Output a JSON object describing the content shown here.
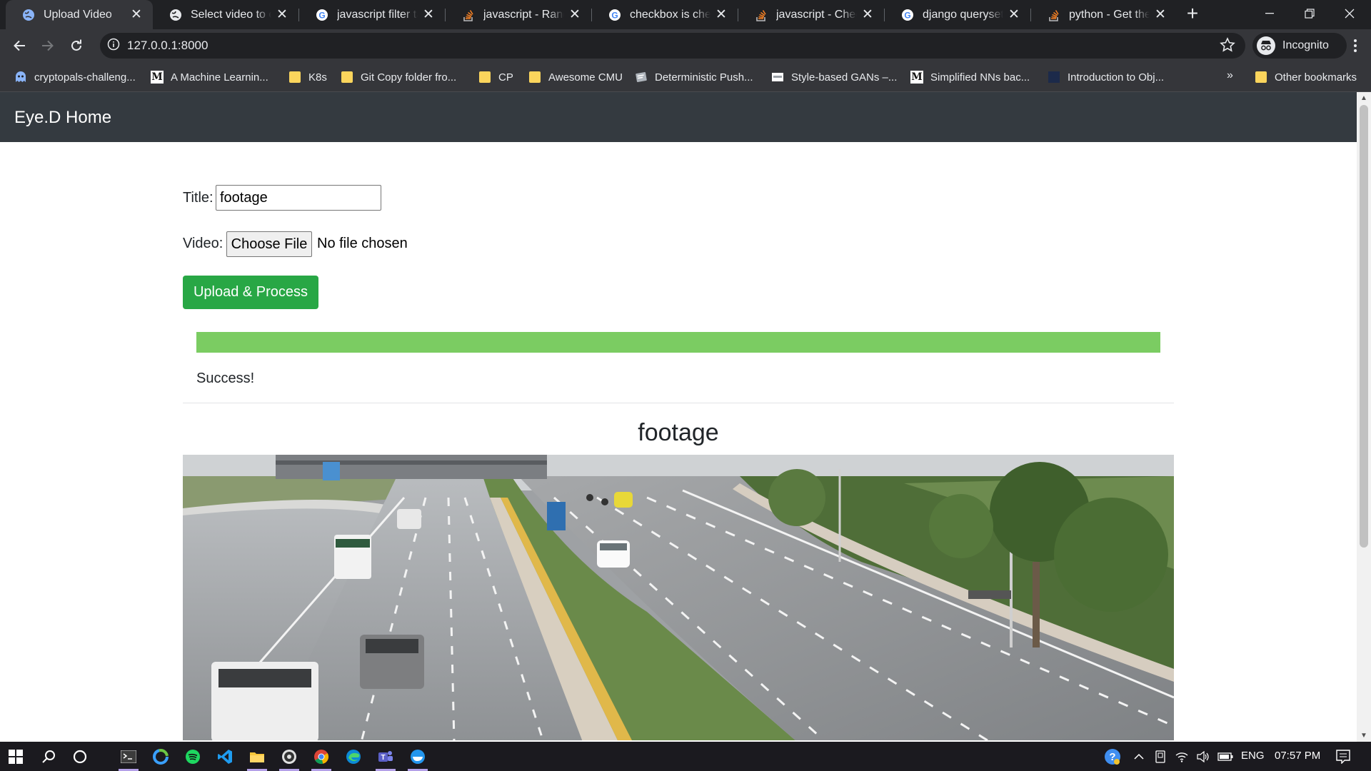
{
  "browser": {
    "tabs": [
      {
        "title": "Upload Video",
        "icon": "globe-icon",
        "active": true
      },
      {
        "title": "Select video to cha",
        "icon": "globe-icon",
        "active": false
      },
      {
        "title": "javascript filter tab",
        "icon": "google-icon",
        "active": false
      },
      {
        "title": "javascript - Range",
        "icon": "stackoverflow-icon",
        "active": false
      },
      {
        "title": "checkbox is checke",
        "icon": "google-icon",
        "active": false
      },
      {
        "title": "javascript - Check",
        "icon": "stackoverflow-icon",
        "active": false
      },
      {
        "title": "django queryset g",
        "icon": "google-icon",
        "active": false
      },
      {
        "title": "python - Get the la",
        "icon": "stackoverflow-icon",
        "active": false
      }
    ],
    "address": "127.0.0.1:8000",
    "incognito_label": "Incognito",
    "bookmarks": [
      {
        "label": "cryptopals-challeng...",
        "icon": "cryptopals-icon"
      },
      {
        "label": "A Machine Learnin...",
        "icon": "medium-icon"
      },
      {
        "label": "K8s",
        "icon": "folder-icon"
      },
      {
        "label": "Git Copy folder fro...",
        "icon": "folder-icon"
      },
      {
        "label": "CP",
        "icon": "folder-icon"
      },
      {
        "label": "Awesome CMU",
        "icon": "folder-icon"
      },
      {
        "label": "Deterministic Push...",
        "icon": "page-icon"
      },
      {
        "label": "Style-based GANs –...",
        "icon": "page-icon"
      },
      {
        "label": "Simplified NNs bac...",
        "icon": "medium-icon"
      },
      {
        "label": "Introduction to Obj...",
        "icon": "page-icon"
      }
    ],
    "other_bookmarks": "Other bookmarks",
    "overflow": "»"
  },
  "page": {
    "brand": "Eye.D Home",
    "form": {
      "title_label": "Title:",
      "title_value": "footage",
      "video_label": "Video:",
      "file_button": "Choose File",
      "file_status": "No file chosen",
      "submit_label": "Upload & Process"
    },
    "progress": {
      "percent": 100,
      "color": "#7bcc62"
    },
    "status": "Success!",
    "video_title": "footage"
  },
  "taskbar": {
    "language": "ENG",
    "time": "07:57 PM"
  },
  "colors": {
    "navbar": "#343a40",
    "success_button": "#28a745",
    "tab_strip": "#202124",
    "toolbar": "#35363a"
  }
}
